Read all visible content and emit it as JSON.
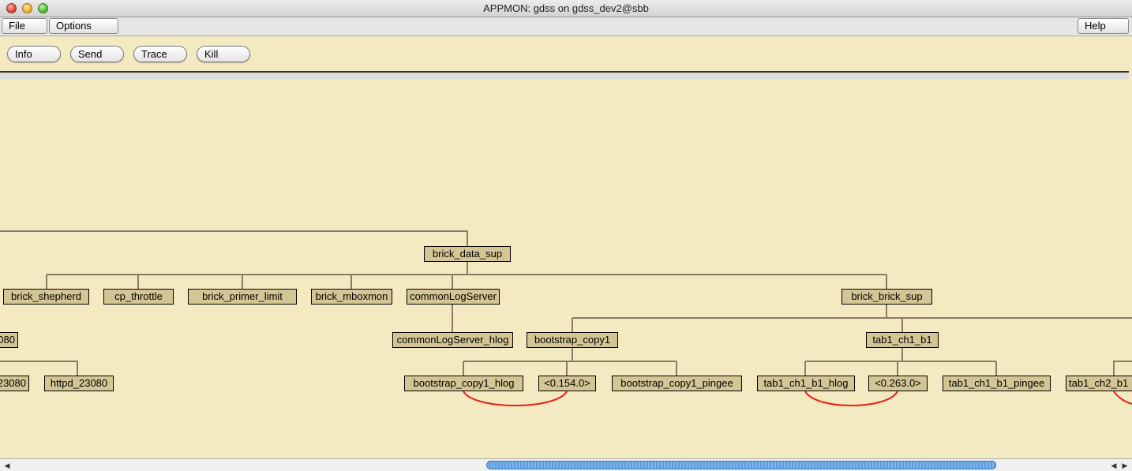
{
  "window": {
    "title": "APPMON: gdss on gdss_dev2@sbb"
  },
  "menu": {
    "file": "File",
    "options": "Options",
    "help": "Help"
  },
  "toolbar": {
    "info": "Info",
    "send": "Send",
    "trace": "Trace",
    "kill": "Kill"
  },
  "tree": {
    "nodes": [
      "brick_data_sup",
      "brick_shepherd",
      "cp_throttle",
      "brick_primer_limit",
      "brick_mboxmon",
      "commonLogServer",
      "brick_brick_sup",
      "080",
      "commonLogServer_hlog",
      "bootstrap_copy1",
      "tab1_ch1_b1",
      "23080",
      "httpd_23080",
      "bootstrap_copy1_hlog",
      "<0.154.0>",
      "bootstrap_copy1_pingee",
      "tab1_ch1_b1_hlog",
      "<0.263.0>",
      "tab1_ch1_b1_pingee",
      "tab1_ch2_b1"
    ]
  },
  "colors": {
    "background": "#f3eac1",
    "node_fill": "#d4c694",
    "link_line": "#8a7a66",
    "link_arc": "#e8201a"
  }
}
